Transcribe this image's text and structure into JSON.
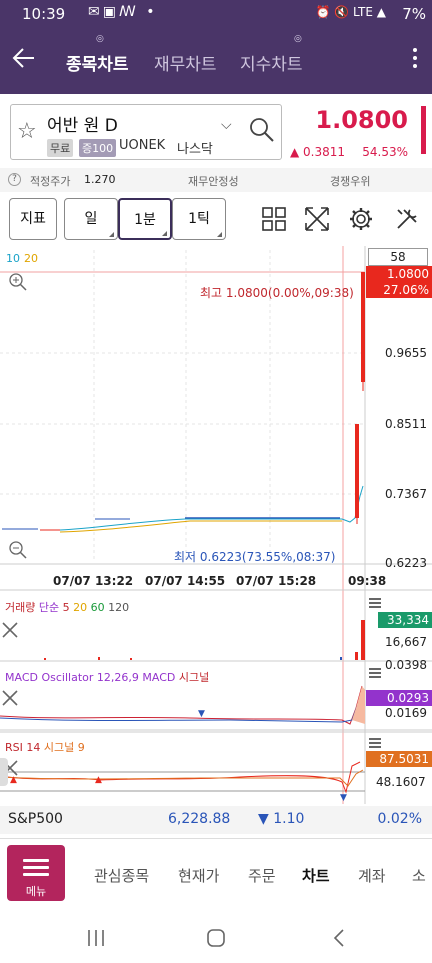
{
  "status": {
    "time": "10:39",
    "battery": "7%"
  },
  "header": {
    "tabs": [
      {
        "label": "종목차트"
      },
      {
        "label": "재무차트"
      },
      {
        "label": "지수차트"
      }
    ]
  },
  "stock": {
    "name": "어반 원 D",
    "badge_free": "무료",
    "badge_margin": "증100",
    "code": "UONEK",
    "exchange": "나스닥",
    "price": "1.0800",
    "change": "0.3811",
    "change_pct": "54.53%"
  },
  "info": {
    "fair_price_label": "적정주가",
    "fair_price": "1.270",
    "stability_label": "재무안정성",
    "competition_label": "경쟁우위"
  },
  "toolbar": {
    "indicator": "지표",
    "day": "일",
    "minute": "1분",
    "tick": "1틱"
  },
  "chart": {
    "ma_legend": [
      "10",
      "20"
    ],
    "max_label": "최고 1.0800(0.00%,09:38)",
    "min_label": "최저 0.6223(73.55%,08:37)",
    "count_box": "58",
    "price_tag": "1.0800",
    "pct_tag": "27.06%",
    "y_ticks": [
      "0.9655",
      "0.8511",
      "0.7367",
      "0.6223"
    ],
    "x_ticks": [
      "07/07 13:22",
      "07/07 14:55",
      "07/07 15:28",
      "09:38"
    ],
    "volume": {
      "label_a": "거래량",
      "label_b": "단순",
      "periods": [
        "5",
        "20",
        "60",
        "120"
      ],
      "tag": "33,334",
      "tick": "16,667"
    },
    "macd": {
      "label": "MACD Oscillator 12,26,9",
      "macd": "MACD",
      "signal": "시그널",
      "tag": "0.0293",
      "tick1": "0.0398",
      "tick2": "0.0169"
    },
    "rsi": {
      "label": "RSI 14",
      "signal": "시그널 9",
      "tag": "87.5031",
      "tick": "48.1607"
    },
    "colors": {
      "up": "#e8281e",
      "down": "#2a55b8",
      "ma10": "#1aa3c8",
      "ma20": "#e0a500"
    }
  },
  "sp500": {
    "name": "S&P500",
    "value": "6,228.88",
    "change": "1.10",
    "pct": "0.02%"
  },
  "bottom_nav": {
    "menu": "메뉴",
    "items": [
      "관심종목",
      "현재가",
      "주문",
      "차트",
      "계좌",
      "소"
    ]
  }
}
